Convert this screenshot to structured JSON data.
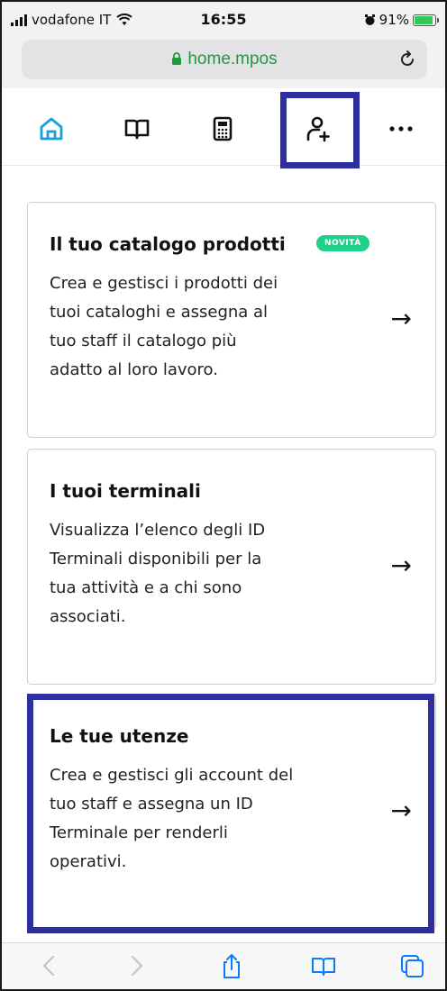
{
  "status_bar": {
    "carrier": "vodafone IT",
    "time": "16:55",
    "battery_percent": "91%",
    "battery_level": 0.91
  },
  "browser": {
    "url": "home.mpos"
  },
  "nav": {
    "items": [
      {
        "name": "home",
        "icon": "home-icon",
        "active": true
      },
      {
        "name": "catalog",
        "icon": "book-icon"
      },
      {
        "name": "terminal",
        "icon": "calculator-icon"
      },
      {
        "name": "users",
        "icon": "add-user-icon"
      },
      {
        "name": "more",
        "icon": "more-icon"
      }
    ]
  },
  "cards": [
    {
      "title": "Il tuo catalogo prodotti",
      "badge": "NOVITÀ",
      "description": "Crea e gestisci i prodotti dei tuoi cataloghi e assegna al tuo staff il catalogo più adatto al loro lavoro.",
      "arrow": "→"
    },
    {
      "title": "I tuoi terminali",
      "description": "Visualizza l’elenco degli ID Terminali disponibili per la tua attività e a chi sono associati.",
      "arrow": "→"
    },
    {
      "title": "Le tue utenze",
      "description": "Crea e gestisci gli account del tuo staff e assegna un ID Terminale per renderli operativi.",
      "arrow": "→"
    }
  ],
  "colors": {
    "accent": "#1a9fd8",
    "highlight": "#2d2fa0",
    "badge": "#1fd08a",
    "url_text": "#1e9b3e",
    "safari_blue": "#0a7aff"
  }
}
